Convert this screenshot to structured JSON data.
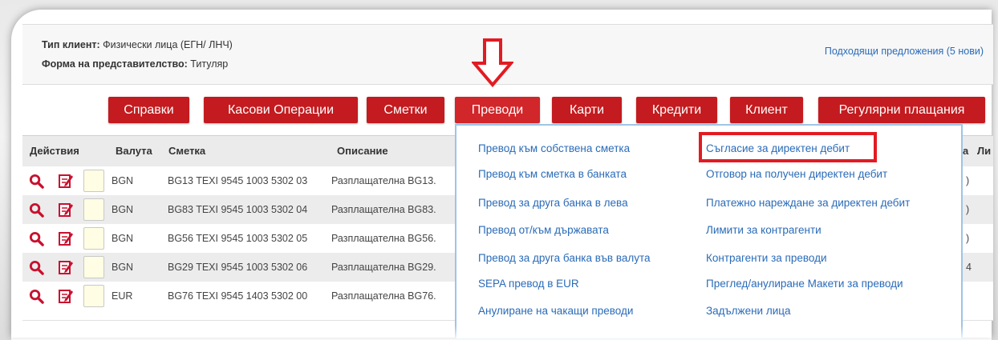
{
  "client": {
    "type_label": "Тип клиент:",
    "type_value": "Физически лица (ЕГН/ ЛНЧ)",
    "form_label": "Форма на представителство:",
    "form_value": "Титуляр",
    "offers_link": "Подходящи предложения (5 нови)"
  },
  "nav": {
    "items": [
      "Справки",
      "Касови Операции",
      "Сметки",
      "Преводи",
      "Карти",
      "Кредити",
      "Клиент",
      "Регулярни плащания"
    ],
    "active": "Преводи"
  },
  "table": {
    "headers": [
      "Действия",
      "Валута",
      "Сметка",
      "Описание"
    ],
    "header_cut": "а",
    "header_cut2": "Ли",
    "rows": [
      {
        "currency": "BGN",
        "account": "BG13 TEXI 9545 1003 5302 03",
        "description": "Разплащателна BG13.",
        "tail": ")"
      },
      {
        "currency": "BGN",
        "account": "BG83 TEXI 9545 1003 5302 04",
        "description": "Разплащателна BG83.",
        "tail": ")"
      },
      {
        "currency": "BGN",
        "account": "BG56 TEXI 9545 1003 5302 05",
        "description": "Разплащателна BG56.",
        "tail": ")"
      },
      {
        "currency": "BGN",
        "account": "BG29 TEXI 9545 1003 5302 06",
        "description": "Разплащателна BG29.",
        "tail": "4"
      },
      {
        "currency": "EUR",
        "account": "BG76 TEXI 9545 1403 5302 00",
        "description": "Разплащателна BG76.",
        "tail": ""
      }
    ]
  },
  "transfers_menu": {
    "left": [
      "Превод към собствена сметка",
      "Превод към сметка в банката",
      "Превод за друга банка в лева",
      "Превод от/към държавата",
      "Превод за друга банка във валута",
      "SEPA превод в EUR",
      "Анулиране на чакащи преводи"
    ],
    "right": [
      "Съгласие за директен дебит",
      "Отговор на получен директен дебит",
      "Платежно нареждане за директен дебит",
      "Лимити за контрагенти",
      "Контрагенти за преводи",
      "Преглед/анулиране Макети за преводи",
      "Задължени лица"
    ],
    "highlighted": "Съгласие за директен дебит"
  },
  "colors": {
    "brand_red": "#c31b1f",
    "link_blue": "#2a6bb8",
    "highlight_red": "#e21b23"
  }
}
